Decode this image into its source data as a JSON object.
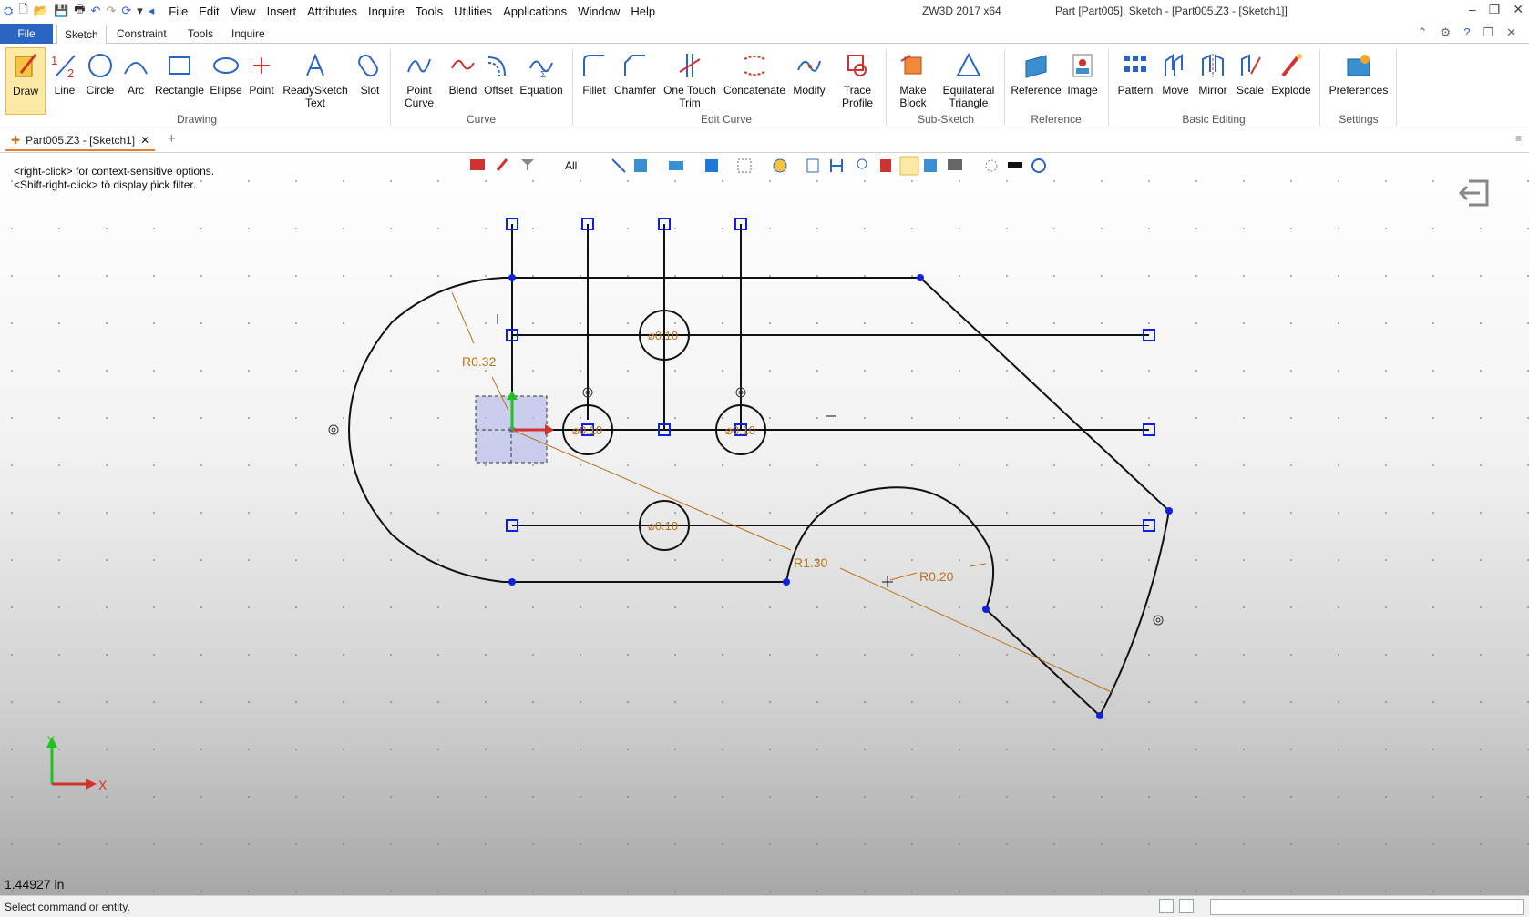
{
  "app": {
    "name": "ZW3D 2017  x64",
    "document": "Part [Part005],  Sketch - [Part005.Z3 - [Sketch1]]"
  },
  "menubar": [
    "File",
    "Edit",
    "View",
    "Insert",
    "Attributes",
    "Inquire",
    "Tools",
    "Utilities",
    "Applications",
    "Window",
    "Help"
  ],
  "ribbon_tabs": {
    "file": "File",
    "sketch": "Sketch",
    "constraint": "Constraint",
    "tools": "Tools",
    "inquire": "Inquire"
  },
  "ribbon": {
    "drawing": {
      "draw": "Draw",
      "line": "Line",
      "circle": "Circle",
      "arc": "Arc",
      "rectangle": "Rectangle",
      "ellipse": "Ellipse",
      "point": "Point",
      "readysketch1": "ReadySketch",
      "readysketch2": "Text",
      "slot": "Slot",
      "group": "Drawing"
    },
    "curve": {
      "point_curve1": "Point",
      "point_curve2": "Curve",
      "blend": "Blend",
      "offset": "Offset",
      "equation": "Equation",
      "group": "Curve"
    },
    "edit": {
      "fillet": "Fillet",
      "chamfer": "Chamfer",
      "trim1": "One Touch",
      "trim2": "Trim",
      "concatenate": "Concatenate",
      "modify": "Modify",
      "trace1": "Trace",
      "trace2": "Profile",
      "group": "Edit Curve"
    },
    "subsketch": {
      "make1": "Make",
      "make2": "Block",
      "eq1": "Equilateral",
      "eq2": "Triangle",
      "group": "Sub-Sketch"
    },
    "reference": {
      "reference": "Reference",
      "image": "Image",
      "group": "Reference"
    },
    "basic": {
      "pattern": "Pattern",
      "move": "Move",
      "mirror": "Mirror",
      "scale": "Scale",
      "explode": "Explode",
      "group": "Basic Editing"
    },
    "settings": {
      "preferences": "Preferences",
      "group": "Settings"
    }
  },
  "doc_tab": "Part005.Z3 - [Sketch1]",
  "view_toolbar": {
    "filter": "All"
  },
  "hints": [
    "<right-click> for context-sensitive options.",
    "<Shift-right-click> to display pick filter."
  ],
  "dimensions": {
    "r032": "R0.32",
    "r130": "R1.30",
    "r020": "R0.20",
    "d1": "⌀0.10",
    "d2": "⌀0.10",
    "d3": "⌀0.10",
    "d4": "⌀0.10"
  },
  "axes": {
    "x": "X",
    "y": "Y"
  },
  "readout": "1.44927 in",
  "status": "Select command or entity.",
  "colors": {
    "file_tab": "#2b65c4",
    "dimension": "#b8731b",
    "geometry": "#111111",
    "point": "#1020e0",
    "active_tool": "#fde9a6"
  }
}
